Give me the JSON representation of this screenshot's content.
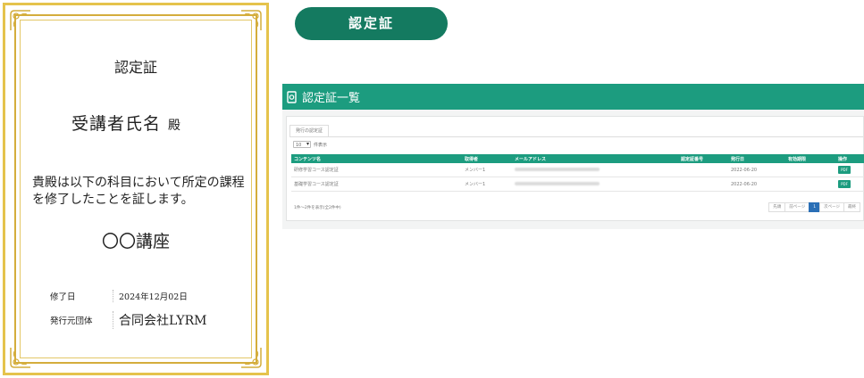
{
  "certificate": {
    "title": "認定証",
    "recipient": "受講者氏名",
    "honorific": "殿",
    "body": "貴殿は以下の科目において所定の課程を修了したことを証します。",
    "course": "〇〇講座",
    "completion_label": "修了日",
    "completion_date": "2024年12月02日",
    "issuer_label": "発行元団体",
    "issuer": "合同会社LYRM"
  },
  "section_pill": {
    "label": "認定証"
  },
  "list": {
    "header_title": "認定証一覧",
    "tab_label": "発行の認定証",
    "per_page_value": "10",
    "per_page_suffix": "件表示",
    "columns": [
      "コンテンツ名",
      "取得者",
      "メールアドレス",
      "認定証番号",
      "発行日",
      "有効期限",
      "操作"
    ],
    "rows": [
      {
        "content": "研修学習コース認定証",
        "holder": "メンバー1",
        "issued": "2022-06-20",
        "action": "PDF"
      },
      {
        "content": "基礎学習コース認定証",
        "holder": "メンバー1",
        "issued": "2022-06-20",
        "action": "PDF"
      }
    ],
    "summary": "1件～2件を表示(全2件中)",
    "pager": [
      "先頭",
      "前ページ",
      "1",
      "次ページ",
      "最終"
    ]
  },
  "colors": {
    "gold": "#e5c34c",
    "pill": "#147a60",
    "header": "#1c9c7f",
    "pager_active": "#2a6fb6"
  }
}
